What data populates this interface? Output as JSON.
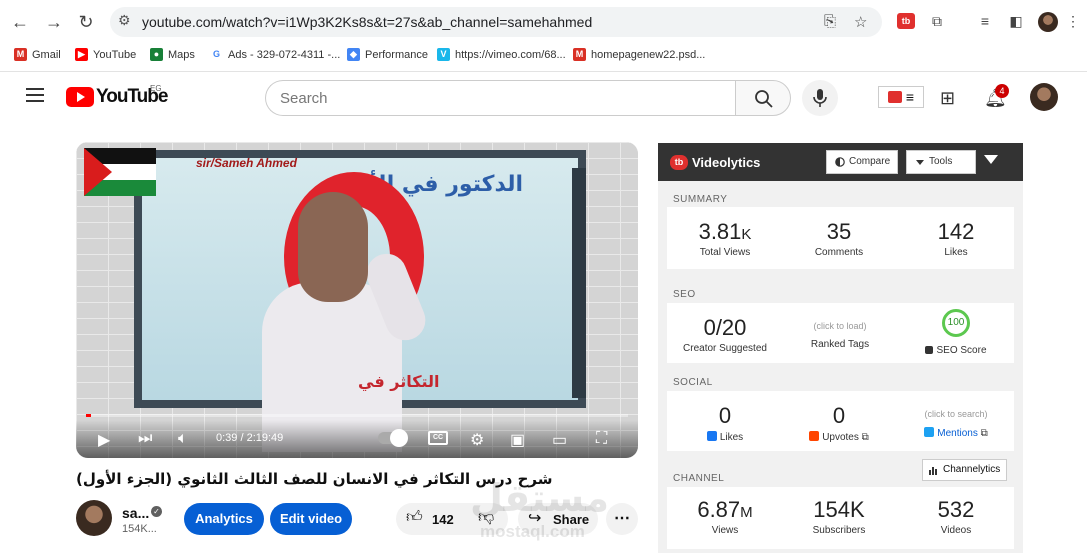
{
  "browser": {
    "url": "youtube.com/watch?v=i1Wp3K2Ks8s&t=27s&ab_channel=samehahmed",
    "bookmarks": [
      {
        "label": "Gmail",
        "color": "#d93025"
      },
      {
        "label": "YouTube",
        "color": "#ff0000"
      },
      {
        "label": "Maps",
        "color": "#188038"
      },
      {
        "label": "Ads - 329-072-4311 -...",
        "color": "#4285f4"
      },
      {
        "label": "Performance",
        "color": "#4285f4"
      },
      {
        "label": "https://vimeo.com/68...",
        "color": "#1ab7ea"
      },
      {
        "label": "homepagenew22.psd...",
        "color": "#d93025"
      }
    ]
  },
  "youtube": {
    "logo_text": "YouTube",
    "country_code": "EG",
    "search_placeholder": "Search",
    "notification_count": "4"
  },
  "player": {
    "board_name": "sir/Sameh Ahmed",
    "board_heading": "الدكتور في الأحياء",
    "board_footer": "التكاثر في",
    "time_current": "0:39",
    "time_total": "2:19:49",
    "time_display": "0:39 / 2:19:49",
    "progress_fraction": 0.005,
    "cc_label": "CC"
  },
  "video": {
    "title": "شرح درس التكاثر في الانسان للصف الثالث الثانوي (الجزء الأول)",
    "channel_name": "sa...",
    "channel_subs": "154K...",
    "analytics_label": "Analytics",
    "edit_label": "Edit video",
    "like_count": "142",
    "share_label": "Share"
  },
  "watermark": {
    "arabic": "مستقل",
    "latin": "mostaql.com"
  },
  "videolytics": {
    "title": "Videolytics",
    "logo_text": "tb",
    "compare_label": "Compare",
    "tools_label": "Tools",
    "summary_label": "SUMMARY",
    "summary": [
      {
        "value": "3.81",
        "suffix": "K",
        "label": "Total Views"
      },
      {
        "value": "35",
        "suffix": "",
        "label": "Comments"
      },
      {
        "value": "142",
        "suffix": "",
        "label": "Likes"
      }
    ],
    "seo_label": "SEO",
    "seo": {
      "creator_value": "0/20",
      "creator_label": "Creator Suggested",
      "ranked_hint": "(click to load)",
      "ranked_label": "Ranked Tags",
      "score_value": "100",
      "score_label": "SEO Score"
    },
    "social_label": "SOCIAL",
    "social": {
      "likes_value": "0",
      "likes_label": "Likes",
      "upvotes_value": "0",
      "upvotes_label": "Upvotes",
      "mentions_hint": "(click to search)",
      "mentions_label": "Mentions"
    },
    "channel_label": "CHANNEL",
    "channelytics_label": "Channelytics",
    "channel": [
      {
        "value": "6.87",
        "suffix": "M",
        "label": "Views"
      },
      {
        "value": "154K",
        "suffix": "",
        "label": "Subscribers"
      },
      {
        "value": "532",
        "suffix": "",
        "label": "Videos"
      }
    ]
  }
}
